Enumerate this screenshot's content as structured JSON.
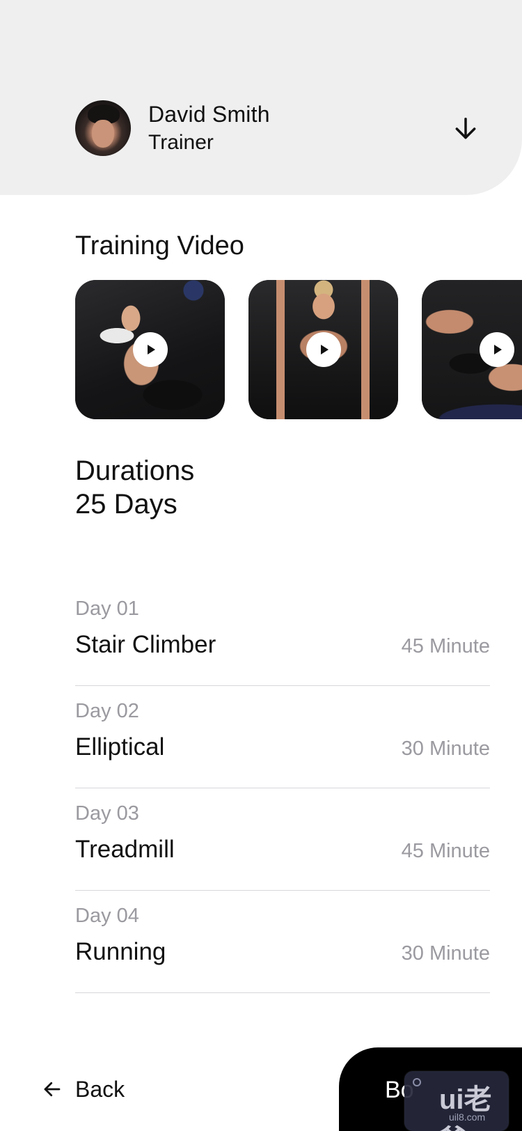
{
  "header": {
    "trainer_name": "David Smith",
    "trainer_role": "Trainer",
    "avatar_icon": "avatar-photo",
    "expand_icon": "arrow-down-icon"
  },
  "training": {
    "title": "Training Video",
    "videos": [
      {
        "thumbnail": "woman-lifting-dumbbells",
        "play_icon": "play-icon"
      },
      {
        "thumbnail": "woman-doing-pushups",
        "play_icon": "play-icon"
      },
      {
        "thumbnail": "woman-doing-crunches",
        "play_icon": "play-icon"
      }
    ]
  },
  "duration": {
    "label": "Durations",
    "value": "25 Days"
  },
  "days": [
    {
      "day": "Day 01",
      "activity": "Stair Climber",
      "duration": "45 Minute"
    },
    {
      "day": "Day 02",
      "activity": "Elliptical",
      "duration": "30 Minute"
    },
    {
      "day": "Day 03",
      "activity": "Treadmill",
      "duration": "45 Minute"
    },
    {
      "day": "Day 04",
      "activity": "Running",
      "duration": "30 Minute"
    }
  ],
  "footer": {
    "back_label": "Back",
    "book_label": "Bo",
    "back_icon": "arrow-left-icon"
  },
  "watermark": {
    "logo": "ui老爸",
    "url": "uil8.com"
  },
  "colors": {
    "header_bg": "#efefef",
    "primary_text": "#111111",
    "secondary_text": "#9a9aa0",
    "divider": "#d7d7dc",
    "button_bg": "#000000"
  }
}
